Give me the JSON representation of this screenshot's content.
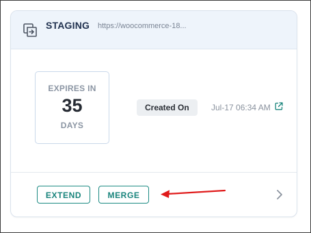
{
  "header": {
    "site_name": "STAGING",
    "site_url": "https://woocommerce-18..."
  },
  "expiry": {
    "label": "EXPIRES IN",
    "value": "35",
    "unit": "DAYS"
  },
  "created": {
    "badge_label": "Created On",
    "date": "Jul-17 06:34 AM"
  },
  "actions": {
    "extend_label": "EXTEND",
    "merge_label": "MERGE"
  },
  "colors": {
    "accent": "#17837b",
    "annotation_arrow": "#e01b1b",
    "header_bg": "#eef4fb"
  },
  "icons": {
    "header": "staging-copy-icon",
    "external": "external-link-icon",
    "chevron": "chevron-right-icon"
  }
}
